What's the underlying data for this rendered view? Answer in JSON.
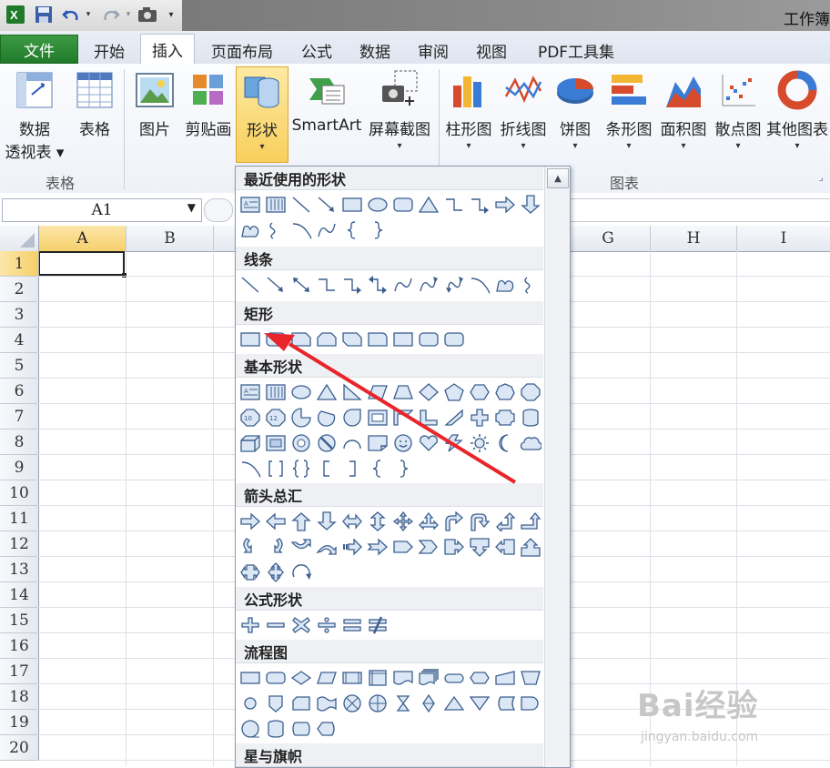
{
  "window": {
    "app_title": "工作簿",
    "qat": {
      "excel_icon": "excel-logo-icon",
      "save_icon": "save-icon",
      "undo_icon": "undo-icon",
      "redo_icon": "redo-icon",
      "camera_icon": "camera-icon",
      "customize_icon": "chevron-down-icon"
    }
  },
  "tabs": [
    "文件",
    "开始",
    "插入",
    "页面布局",
    "公式",
    "数据",
    "审阅",
    "视图",
    "PDF工具集"
  ],
  "active_tab": "插入",
  "ribbon": {
    "groups": [
      {
        "label": "表格",
        "buttons": [
          {
            "label1": "数据",
            "label2": "透视表 ▾",
            "icon": "pivot-table-icon"
          },
          {
            "label1": "表格",
            "icon": "table-icon"
          }
        ]
      },
      {
        "label": "",
        "buttons": [
          {
            "label1": "图片",
            "icon": "picture-icon"
          },
          {
            "label1": "剪贴画",
            "icon": "clipart-icon"
          },
          {
            "label1": "形状",
            "icon": "shapes-icon"
          },
          {
            "label1": "SmartArt",
            "icon": "smartart-icon"
          },
          {
            "label1": "屏幕截图",
            "icon": "screenshot-icon"
          }
        ]
      },
      {
        "label": "图表",
        "buttons": [
          {
            "label1": "柱形图",
            "icon": "column-chart-icon"
          },
          {
            "label1": "折线图",
            "icon": "line-chart-icon"
          },
          {
            "label1": "饼图",
            "icon": "pie-chart-icon"
          },
          {
            "label1": "条形图",
            "icon": "bar-chart-icon"
          },
          {
            "label1": "面积图",
            "icon": "area-chart-icon"
          },
          {
            "label1": "散点图",
            "icon": "scatter-chart-icon"
          },
          {
            "label1": "其他图表",
            "icon": "other-charts-icon"
          }
        ]
      }
    ]
  },
  "formula_bar": {
    "name_box": "A1"
  },
  "sheet": {
    "columns": [
      "A",
      "B",
      "G",
      "H",
      "I"
    ],
    "rows": [
      "1",
      "2",
      "3",
      "4",
      "5",
      "6",
      "7",
      "8",
      "9",
      "10",
      "11",
      "12",
      "13",
      "14",
      "15",
      "16",
      "17",
      "18",
      "19",
      "20"
    ],
    "selected_cell": "A1"
  },
  "shapes_panel": {
    "categories": [
      {
        "title": "最近使用的形状",
        "count": 22
      },
      {
        "title": "线条",
        "count": 12
      },
      {
        "title": "矩形",
        "count": 9
      },
      {
        "title": "基本形状",
        "count": 42
      },
      {
        "title": "箭头总汇",
        "count": 28
      },
      {
        "title": "公式形状",
        "count": 6
      },
      {
        "title": "流程图",
        "count": 28
      },
      {
        "title": "星与旗帜",
        "count": 0
      }
    ]
  },
  "annotation": {
    "arrow_color": "#e8252a"
  },
  "watermark": {
    "brand": "Bai经验",
    "url": "jingyan.baidu.com"
  }
}
